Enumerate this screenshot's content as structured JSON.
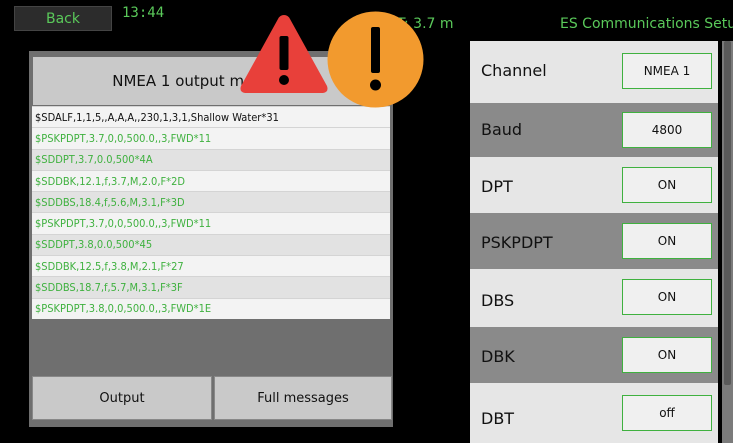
{
  "topbar": {
    "back_label": "Back",
    "time": "13:44",
    "depth": "T: 3.7 m",
    "title": "ES Communications Setup"
  },
  "output_panel": {
    "heading": "NMEA 1 output messages:",
    "messages": [
      "$SDALF,1,1,5,,A,A,A,,230,1,3,1,Shallow Water*31",
      "$PSKPDPT,3.7,0,0,500.0,,3,FWD*11",
      "$SDDPT,3.7,0.0,500*4A",
      "$SDDBK,12.1,f,3.7,M,2.0,F*2D",
      "$SDDBS,18.4,f,5.6,M,3.1,F*3D",
      "$PSKPDPT,3.7,0,0,500.0,,3,FWD*11",
      "$SDDPT,3.8,0.0,500*45",
      "$SDDBK,12.5,f,3.8,M,2.1,F*27",
      "$SDDBS,18.7,f,5.7,M,3.1,F*3F",
      "$PSKPDPT,3.8,0,0,500.0,,3,FWD*1E"
    ],
    "output_button": "Output",
    "full_messages_button": "Full messages"
  },
  "settings": [
    {
      "label": "Channel",
      "value": "NMEA 1"
    },
    {
      "label": "Baud",
      "value": "4800"
    },
    {
      "label": "DPT",
      "value": "ON"
    },
    {
      "label": "PSKPDPT",
      "value": "ON"
    },
    {
      "label": "DBS",
      "value": "ON"
    },
    {
      "label": "DBK",
      "value": "ON"
    },
    {
      "label": "DBT",
      "value": "off"
    }
  ],
  "icons": {
    "warning_triangle": "warning-triangle-icon",
    "warning_circle": "warning-circle-icon"
  },
  "colors": {
    "accent_green": "#3fb13f",
    "warning_red": "#e8403a",
    "warning_orange": "#f29a2e"
  }
}
